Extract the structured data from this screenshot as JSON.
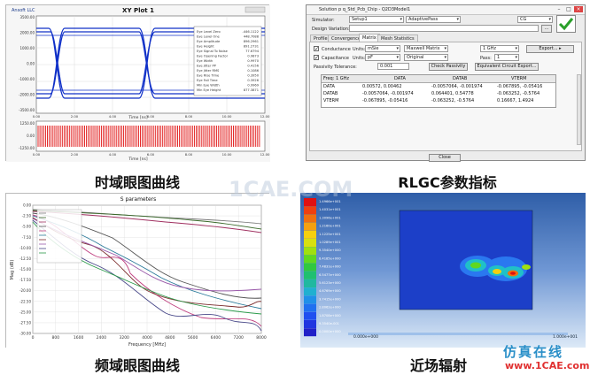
{
  "captions": {
    "eye_time": "时域眼图曲线",
    "rlgc": "RLGC参数指标",
    "eye_freq": "频域眼图曲线",
    "near_field": "近场辐射"
  },
  "watermark": {
    "center": "1CAE.COM",
    "logo_cn": "仿真在线",
    "logo_url": "www.1CAE.com"
  },
  "xy_plot": {
    "title": "XY Plot 1",
    "vendor": "Ansoft LLC",
    "upper_xlabel": "Time [ns]",
    "lower_xlabel": "Time [ns]",
    "x_ticks": [
      "0.00",
      "2.00",
      "4.00",
      "6.00",
      "8.00",
      "10.00",
      "12.00"
    ],
    "upper_y_ticks": [
      "3500.00",
      "2000.00",
      "1000.00",
      "0.00",
      "-1000.00",
      "-2000.00",
      "-3500.00"
    ],
    "lower_y_ticks": [
      "1250.00",
      "0.00",
      "-1250.00"
    ],
    "info_rows": [
      [
        "Eye Level Zero",
        "-446.1122"
      ],
      [
        "Eye Level One",
        "448.7088"
      ],
      [
        "Eye Amplitude",
        "896.2961"
      ],
      [
        "Eye Height",
        "891.2731"
      ],
      [
        "Eye Signal To Noise",
        "77.6794"
      ],
      [
        "Eye Opening Factor",
        "0.9873"
      ],
      [
        "Eye Width",
        "0.9970"
      ],
      [
        "Eye Jitter PP",
        "0.4156"
      ],
      [
        "Eye Jitter RMS",
        "0.1086"
      ],
      [
        "Eye Rise Time",
        "0.3950"
      ],
      [
        "Eye Fall Time",
        "0.3926"
      ],
      [
        "Min Eye Width",
        "0.9969"
      ],
      [
        "Min Eye Height",
        "877.3871"
      ]
    ]
  },
  "rlgc_dialog": {
    "title": "Solution p q_Std_Pcb_Chip - Q2D3Model1",
    "simulator_label": "Simulator:",
    "simulator_value": "Setup1",
    "sweep_value": "AdaptivePass",
    "param_value": "CG",
    "design_variation_label": "Design Variation:",
    "tabs": [
      "Profile",
      "Convergence",
      "Matrix",
      "Mesh Statistics"
    ],
    "active_tab": "Matrix",
    "conductance_label": "Conductance",
    "conductance_units_label": "Units:",
    "conductance_units": "mSie",
    "capacitance_label": "Capacitance",
    "capacitance_units_label": "Units:",
    "capacitance_units": "pF",
    "matrix_type": "Maxwell Matrix",
    "matrix_view": "Original",
    "freq": "1 GHz",
    "pass_label": "Pass:",
    "pass_value": "1",
    "export_label": "Export...",
    "passivity_label": "Passivity Tolerance:",
    "passivity_value": "0.001",
    "check_passivity": "Check Passivity",
    "eq_circuit": "Equivalent Circuit Export...",
    "table": {
      "header": [
        "Freq: 1 GHz",
        "DATA",
        "DATAB",
        "VTERM"
      ],
      "rows": [
        [
          "DATA",
          "0.00572, 0.00462",
          "-0.0057064, -0.001974",
          "-0.067895, -0.05416"
        ],
        [
          "DATAB",
          "-0.0057064, -0.001974",
          "0.064401, 0.54778",
          "-0.063252, -0.5764"
        ],
        [
          "VTERM",
          "-0.067895, -0.05416",
          "-0.063252, -0.5764",
          "0.16667, 1.4924"
        ]
      ]
    },
    "close_label": "Close"
  },
  "sparam": {
    "title": "S parameters",
    "ylabel": "Mag (dB)",
    "xlabel": "Frequency [MHz]",
    "x_ticks": [
      "0",
      "800",
      "1600",
      "2400",
      "3200",
      "4000",
      "4800",
      "5600",
      "6400",
      "7200",
      "8000"
    ],
    "y_ticks": [
      "0.00",
      "-2.50",
      "-5.00",
      "-7.50",
      "-10.00",
      "-12.50",
      "-15.00",
      "-17.50",
      "-20.00",
      "-22.50",
      "-25.00",
      "-27.50",
      "-30.00"
    ]
  },
  "nearfield": {
    "legend_values": [
      "1.4966e+001",
      "1.4031e+001",
      "1.3096e+001",
      "1.2160e+001",
      "1.1225e+001",
      "1.0289e+001",
      "9.3540e+000",
      "8.4185e+000",
      "7.4831e+000",
      "6.5477e+000",
      "5.6123e+000",
      "4.6769e+000",
      "3.7415e+000",
      "2.8062e+000",
      "1.8708e+000",
      "9.3540e-001",
      "0.0000e+000"
    ],
    "legend_colors": [
      "#e01010",
      "#ef4010",
      "#f07010",
      "#f5a010",
      "#f5d010",
      "#d8e010",
      "#a0e010",
      "#60d820",
      "#30c840",
      "#20c070",
      "#20b8a0",
      "#20b0d0",
      "#2090e8",
      "#2070f0",
      "#2050f0",
      "#2035e0",
      "#2020c8"
    ],
    "axis_right": "1.000e+001",
    "axis_left": "0.000e+000"
  }
}
